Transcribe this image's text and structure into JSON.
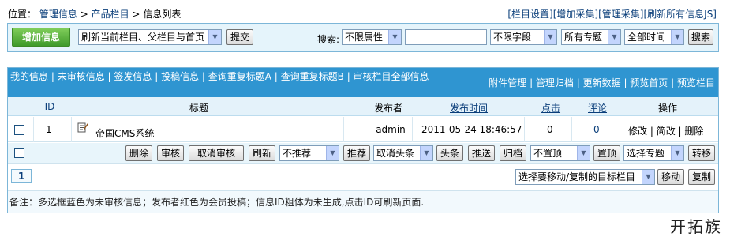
{
  "breadcrumb": {
    "prefix": "位置：",
    "items": [
      "管理信息",
      "产品栏目",
      "信息列表"
    ],
    "sep": ">"
  },
  "top_links": [
    "[栏目设置]",
    "[增加采集]",
    "[管理采集]",
    "[刷新所有信息JS]"
  ],
  "toolbar": {
    "add_label": "增加信息",
    "refresh_select": "刷新当前栏目、父栏目与首页",
    "submit_label": "提交",
    "search_label": "搜索:",
    "attr_select": "不限属性",
    "search_value": "",
    "field_select": "不限字段",
    "topic_select": "所有专题",
    "time_select": "全部时间",
    "search_button": "搜索"
  },
  "menu": {
    "left": [
      "我的信息",
      "未审核信息",
      "签发信息",
      "投稿信息",
      "查询重复标题A",
      "查询重复标题B",
      "审核栏目全部信息"
    ],
    "right": [
      "附件管理",
      "管理归档",
      "更新数据",
      "预览首页",
      "预览栏目"
    ]
  },
  "table": {
    "headers": {
      "id": "ID",
      "title": "标题",
      "publisher": "发布者",
      "time": "发布时间",
      "clicks": "点击",
      "comments": "评论",
      "ops": "操作"
    },
    "rows": [
      {
        "id": "1",
        "title": "帝国CMS系统",
        "publisher": "admin",
        "time": "2011-05-24 18:46:57",
        "clicks": "0",
        "comments": "0",
        "ops": [
          "修改",
          "简改",
          "删除"
        ]
      }
    ]
  },
  "actions": {
    "delete": "删除",
    "approve": "审核",
    "unapprove": "取消审核",
    "refresh": "刷新",
    "recommend_select": "不推荐",
    "recommend": "推荐",
    "headline_select": "取消头条",
    "headline": "头条",
    "push": "推送",
    "archive": "归档",
    "top_select": "不置顶",
    "top": "置顶",
    "topic_select": "选择专题",
    "transfer": "转移"
  },
  "pager": {
    "page": "1",
    "move_select": "选择要移动/复制的目标栏目",
    "move": "移动",
    "copy": "复制"
  },
  "note": "备注：多选框蓝色为未审核信息；发布者红色为会员投稿；信息ID粗体为未生成,点击ID可刷新页面.",
  "watermark": "开拓族"
}
